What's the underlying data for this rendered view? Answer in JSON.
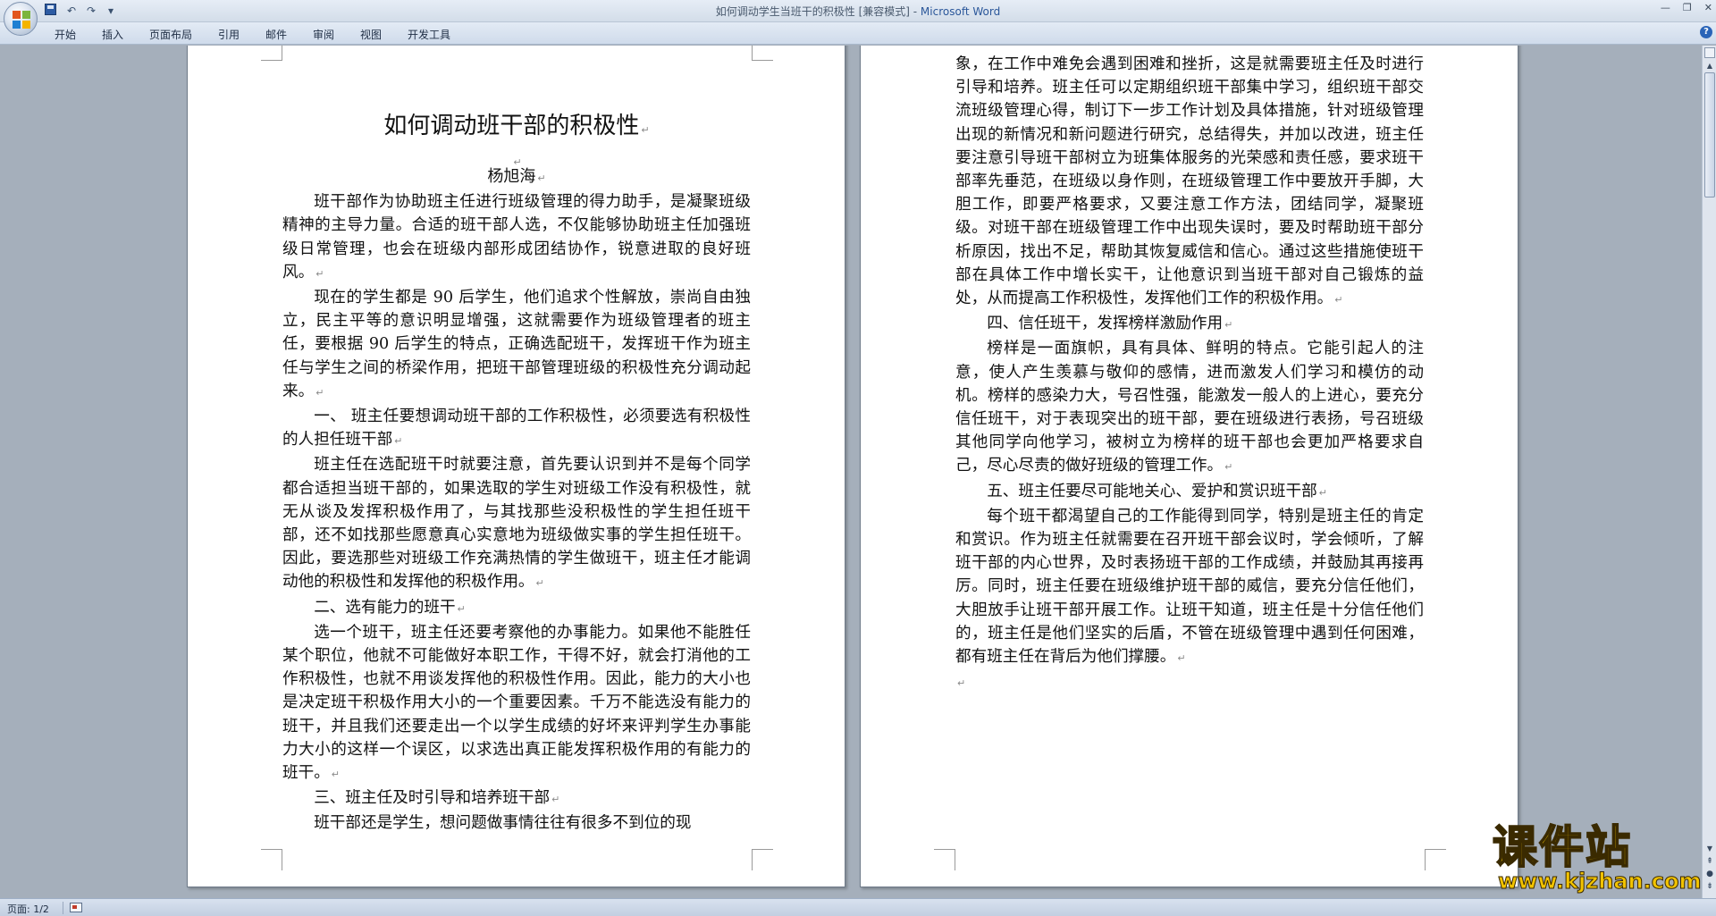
{
  "window": {
    "title": "如何调动学生当班干的积极性 [兼容模式] - ",
    "app_name": "Microsoft Word"
  },
  "quick_access": {
    "icons": [
      "save-icon",
      "undo-icon",
      "redo-icon",
      "customize-icon"
    ]
  },
  "ribbon": {
    "tabs": [
      "开始",
      "插入",
      "页面布局",
      "引用",
      "邮件",
      "审阅",
      "视图",
      "开发工具"
    ]
  },
  "document": {
    "title": "如何调动班干部的积极性",
    "author": "杨旭海",
    "paragraph_mark": "↵",
    "page1": [
      "班干部作为协助班主任进行班级管理的得力助手，是凝聚班级精神的主导力量。合适的班干部人选，不仅能够协助班主任加强班级日常管理，也会在班级内部形成团结协作，锐意进取的良好班风。",
      "现在的学生都是 90 后学生，他们追求个性解放，崇尚自由独立，民主平等的意识明显增强，这就需要作为班级管理者的班主任，要根据 90 后学生的特点，正确选配班干，发挥班干作为班主任与学生之间的桥梁作用，把班干部管理班级的积极性充分调动起来。",
      "一、 班主任要想调动班干部的工作积极性，必须要选有积极性的人担任班干部",
      "班主任在选配班干时就要注意，首先要认识到并不是每个同学都合适担当班干部的，如果选取的学生对班级工作没有积极性，就无从谈及发挥积极作用了，与其找那些没积极性的学生担任班干部，还不如找那些愿意真心实意地为班级做实事的学生担任班干。因此，要选那些对班级工作充满热情的学生做班干，班主任才能调动他的积极性和发挥他的积极作用。",
      "二、选有能力的班干",
      "选一个班干，班主任还要考察他的办事能力。如果他不能胜任某个职位，他就不可能做好本职工作，干得不好，就会打消他的工作积极性，也就不用谈发挥他的积极性作用。因此，能力的大小也是决定班干积极作用大小的一个重要因素。千万不能选没有能力的班干，并且我们还要走出一个以学生成绩的好坏来评判学生办事能力大小的这样一个误区，以求选出真正能发挥积极作用的有能力的班干。",
      "三、班主任及时引导和培养班干部",
      "班干部还是学生，想问题做事情往往有很多不到位的现"
    ],
    "page2": [
      "象，在工作中难免会遇到困难和挫折，这是就需要班主任及时进行引导和培养。班主任可以定期组织班干部集中学习，组织班干部交流班级管理心得，制订下一步工作计划及具体措施，针对班级管理出现的新情况和新问题进行研究，总结得失，并加以改进，班主任要注意引导班干部树立为班集体服务的光荣感和责任感，要求班干部率先垂范，在班级以身作则，在班级管理工作中要放开手脚，大胆工作，即要严格要求，又要注意工作方法，团结同学，凝聚班级。对班干部在班级管理工作中出现失误时，要及时帮助班干部分析原因，找出不足，帮助其恢复威信和信心。通过这些措施使班干部在具体工作中增长实干，让他意识到当班干部对自己锻炼的益处，从而提高工作积极性，发挥他们工作的积极作用。",
      "四、信任班干，发挥榜样激励作用",
      "榜样是一面旗帜，具有具体、鲜明的特点。它能引起人的注意，使人产生羡慕与敬仰的感情，进而激发人们学习和模仿的动机。榜样的感染力大，号召性强，能激发一般人的上进心，要充分信任班干，对于表现突出的班干部，要在班级进行表扬，号召班级其他同学向他学习，被树立为榜样的班干部也会更加严格要求自己，尽心尽责的做好班级的管理工作。",
      "五、班主任要尽可能地关心、爱护和赏识班干部",
      "每个班干都渴望自己的工作能得到同学，特别是班主任的肯定和赏识。作为班主任就需要在召开班干部会议时，学会倾听，了解班干部的内心世界，及时表扬班干部的工作成绩，并鼓励其再接再厉。同时，班主任要在班级维护班干部的威信，要充分信任他们，大胆放手让班干部开展工作。让班干知道，班主任是十分信任他们的，班主任是他们坚实的后盾，不管在班级管理中遇到任何困难，都有班主任在背后为他们撑腰。"
    ]
  },
  "statusbar": {
    "page_info": "页面: 1/2"
  },
  "watermark": {
    "cn": "课件站",
    "url": "www.kjzhan.com"
  }
}
